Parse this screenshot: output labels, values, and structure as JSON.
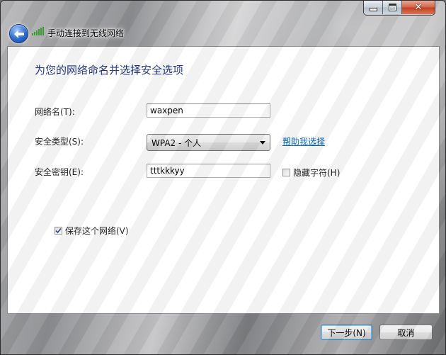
{
  "window": {
    "title": "手动连接到无线网络",
    "icons": {
      "back": "back-arrow-icon",
      "wireless": "wireless-signal-icon",
      "minimize": "minimize-icon",
      "maximize": "maximize-icon",
      "close": "close-icon"
    },
    "accent_colors": {
      "heading": "#1e3287",
      "link": "#0066cc",
      "close_button": "#c3411c"
    }
  },
  "form": {
    "heading": "为您的网络命名并选择安全选项",
    "network_name": {
      "label": "网络名(T):",
      "value": "waxpen"
    },
    "security_type": {
      "label": "安全类型(S):",
      "selected": "WPA2 - 个人"
    },
    "help_link": "帮助我选择",
    "security_key": {
      "label": "安全密钥(E):",
      "value": "tttkkkyy"
    },
    "hide_characters": {
      "label": "隐藏字符(H)",
      "checked": false
    },
    "save_network": {
      "label": "保存这个网络(V)",
      "checked": true
    }
  },
  "buttons": {
    "next": "下一步(N)",
    "cancel": "取消"
  }
}
